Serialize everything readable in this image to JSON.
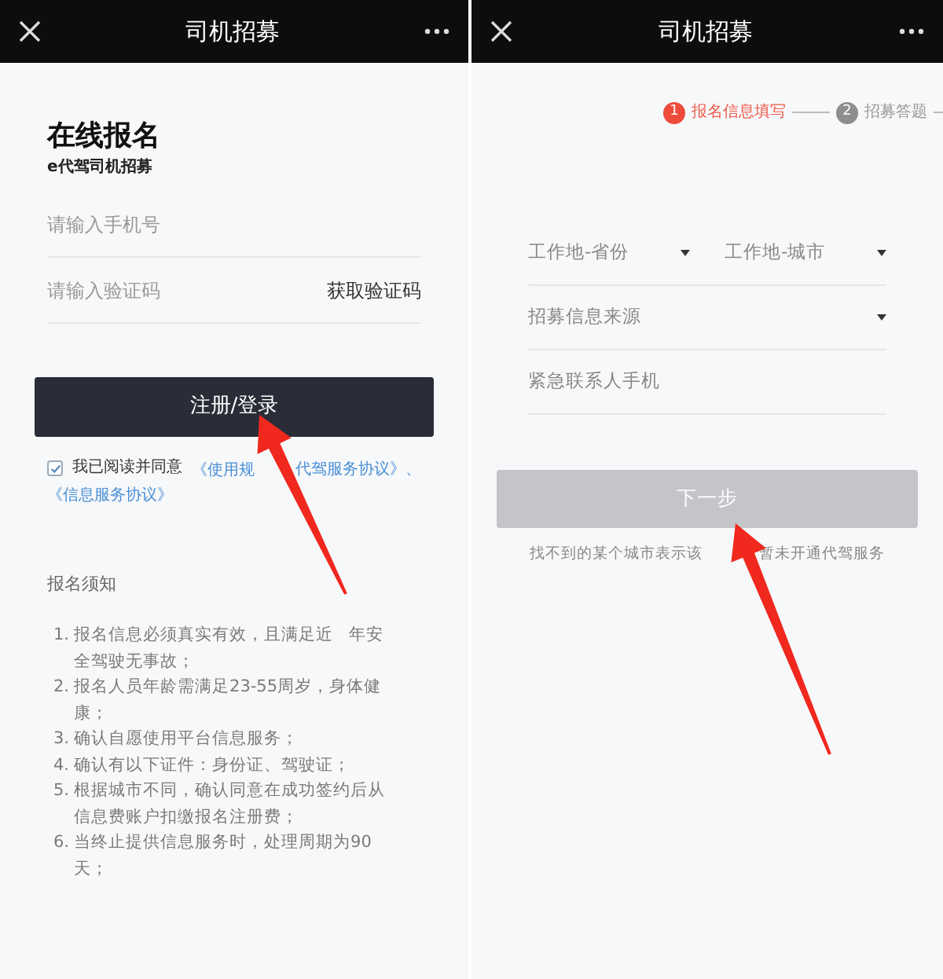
{
  "screens": [
    {
      "title": "司机招募",
      "heading": "在线报名",
      "subheading": "e代驾司机招募",
      "fields": [
        {
          "placeholder": "请输入手机号"
        },
        {
          "placeholder": "请输入验证码",
          "action": "获取验证码"
        }
      ],
      "submit": "注册/登录",
      "agreement": {
        "checked": true,
        "text": "我已阅读并同意",
        "link_parts": [
          "《使用规",
          "代驾服务协议》、"
        ],
        "link2": "《信息服务协议》"
      },
      "notice_title": "报名须知",
      "notices": [
        {
          "number": "1.",
          "parts": [
            "报名信息必须真实有效，且满足近",
            "年安全驾驶无事故；"
          ]
        },
        {
          "number": "2.",
          "parts": [
            "报名人员年龄需满足23-55周岁，身体健康；"
          ]
        },
        {
          "number": "3.",
          "parts": [
            "确认自愿使用平台信息服务；"
          ]
        },
        {
          "number": "4.",
          "parts": [
            "确认有以下证件：身份证、驾驶证；"
          ]
        },
        {
          "number": "5.",
          "parts": [
            "根据城市不同，确认同意在成功签约后从信息费账户扣缴报名注册费；"
          ]
        },
        {
          "number": "6.",
          "parts": [
            "当终止提供信息服务时，处理周期为90天；"
          ]
        }
      ]
    },
    {
      "title": "司机招募",
      "steps": [
        {
          "number": "1",
          "label": "报名信息填写",
          "selected": true
        },
        {
          "number": "2",
          "label": "招募答题",
          "selected": false
        }
      ],
      "selects": [
        [
          "工作地-省份",
          "工作地-城市"
        ],
        [
          "招募信息来源"
        ]
      ],
      "contact_placeholder": "紧急联系人手机",
      "next": {
        "label": "下一步",
        "disabled": true
      },
      "hint_parts": [
        "找不到的某个城市表示该",
        "暂未开通代驾服务"
      ]
    }
  ]
}
